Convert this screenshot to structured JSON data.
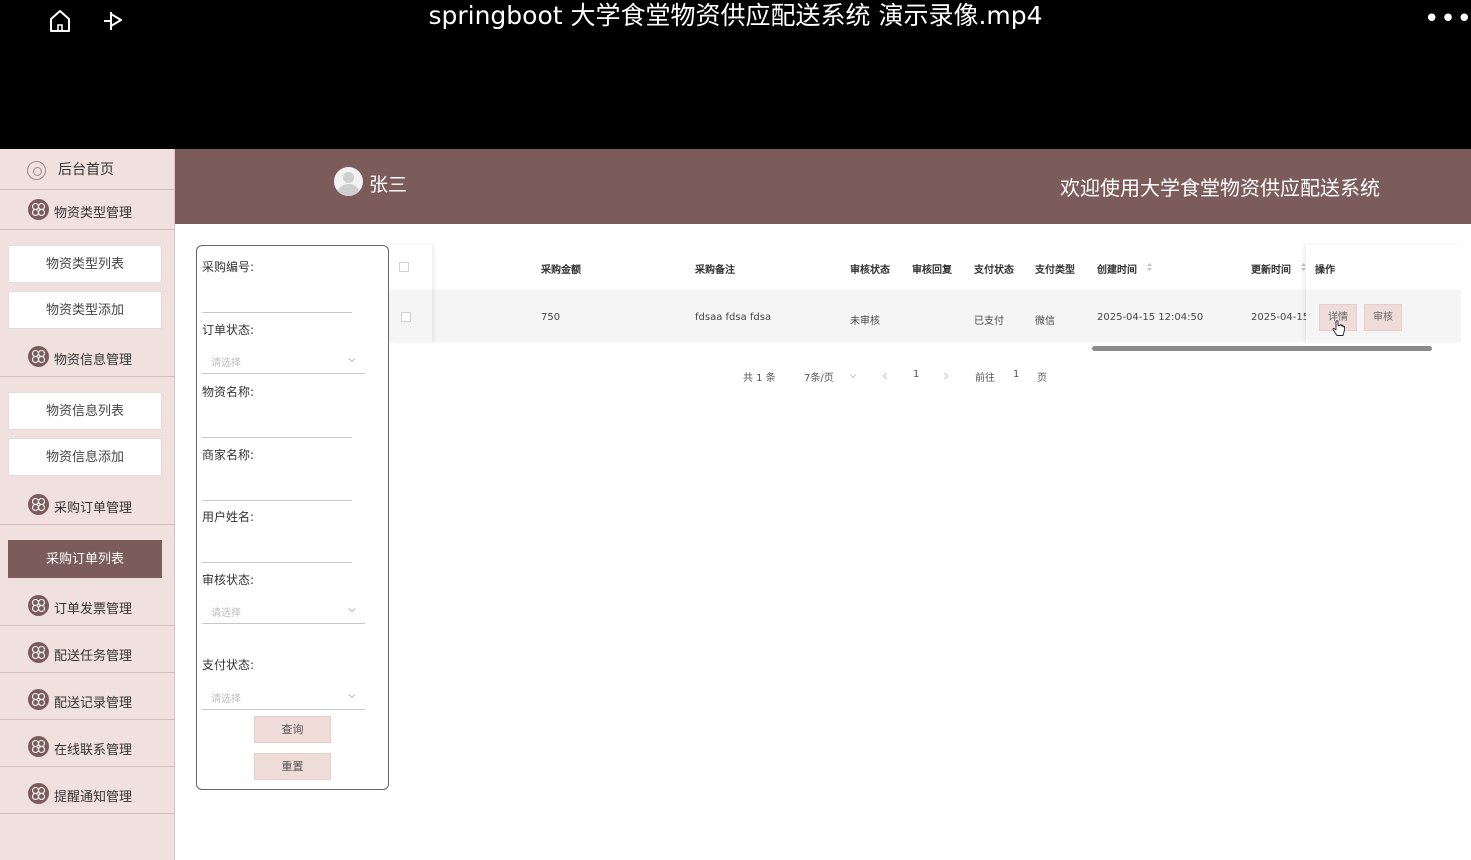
{
  "player": {
    "title": "springboot 大学食堂物资供应配送系统 演示录像.mp4",
    "more": "•••"
  },
  "sidebar": {
    "home": "后台首页",
    "categories": [
      {
        "label": "物资类型管理"
      },
      {
        "label": "物资信息管理"
      },
      {
        "label": "采购订单管理"
      },
      {
        "label": "订单发票管理"
      },
      {
        "label": "配送任务管理"
      },
      {
        "label": "配送记录管理"
      },
      {
        "label": "在线联系管理"
      },
      {
        "label": "提醒通知管理"
      }
    ],
    "subitems": [
      {
        "label": "物资类型列表"
      },
      {
        "label": "物资类型添加"
      },
      {
        "label": "物资信息列表"
      },
      {
        "label": "物资信息添加"
      },
      {
        "label": "采购订单列表",
        "active": true
      }
    ]
  },
  "header": {
    "username": "张三",
    "welcome": "欢迎使用大学食堂物资供应配送系统"
  },
  "search": {
    "fields": [
      {
        "label": "采购编号:"
      },
      {
        "label": "订单状态:",
        "placeholder": "请选择"
      },
      {
        "label": "物资名称:"
      },
      {
        "label": "商家名称:"
      },
      {
        "label": "用户姓名:"
      },
      {
        "label": "审核状态:",
        "placeholder": "请选择"
      },
      {
        "label": "支付状态:",
        "placeholder": "请选择"
      }
    ],
    "query_label": "查询",
    "reset_label": "重置"
  },
  "table": {
    "columns": [
      "采购金额",
      "采购备注",
      "审核状态",
      "审核回复",
      "支付状态",
      "支付类型",
      "创建时间",
      "更新时间",
      "操作"
    ],
    "rows": [
      {
        "amount": "750",
        "remark": "fdsaa fdsa fdsa",
        "audit_status": "未审核",
        "audit_reply": "",
        "pay_status": "已支付",
        "pay_type": "微信",
        "created": "2025-04-15 12:04:50",
        "updated": "2025-04-15"
      }
    ],
    "actions": {
      "detail": "详情",
      "audit": "审核"
    }
  },
  "pagination": {
    "total": "共 1 条",
    "page_size": "7条/页",
    "current": "1",
    "goto_prefix": "前往",
    "goto_value": "1",
    "goto_suffix": "页"
  },
  "colors": {
    "primary": "#7b5c5a",
    "sidebar_bg": "#f0e0de",
    "button_bg": "#efdcd9",
    "pager_active": "#409eff"
  }
}
